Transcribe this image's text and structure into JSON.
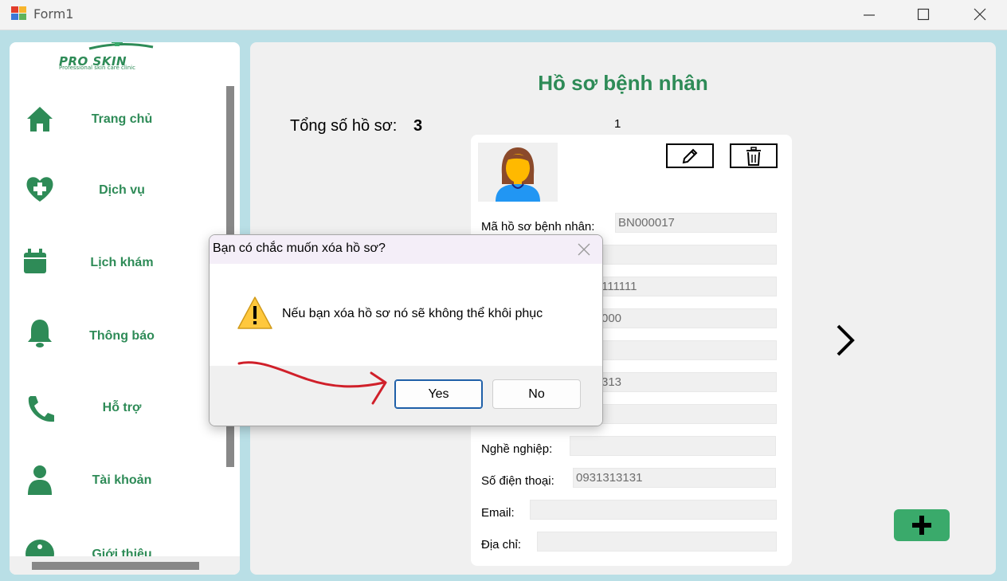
{
  "window": {
    "title": "Form1"
  },
  "colors": {
    "accent": "#2e8b57",
    "background": "#b9dfe6",
    "add_button": "#3aaa6b",
    "annotation_arrow": "#d0202a"
  },
  "sidebar": {
    "logo_text": "PRO SKIN",
    "logo_subtext": "Professional skin care clinic",
    "items": [
      {
        "label": "Trang chủ",
        "icon": "home-icon"
      },
      {
        "label": "Dịch vụ",
        "icon": "heart-plus-icon"
      },
      {
        "label": "Lịch khám",
        "icon": "calendar-icon"
      },
      {
        "label": "Thông báo",
        "icon": "bell-icon"
      },
      {
        "label": "Hỗ trợ",
        "icon": "phone-icon"
      },
      {
        "label": "Tài khoản",
        "icon": "user-icon"
      },
      {
        "label": "Giới thiệu",
        "icon": "info-icon"
      }
    ]
  },
  "main": {
    "title": "Hồ sơ bệnh nhân",
    "total_label": "Tổng số hồ sơ:",
    "total_count": "3",
    "page_number": "1",
    "card": {
      "fields": [
        {
          "label": "Mã hồ sơ bệnh nhân:",
          "value": "BN000017"
        },
        {
          "label": "",
          "value": ""
        },
        {
          "label": "",
          "value": "111111"
        },
        {
          "label": "",
          "value": "000"
        },
        {
          "label": "",
          "value": ""
        },
        {
          "label": "",
          "value": "313"
        },
        {
          "label": "",
          "value": ""
        },
        {
          "label": "Nghề nghiệp:",
          "value": ""
        },
        {
          "label": "Số điện thoại:",
          "value": "0931313131"
        },
        {
          "label": "Email:",
          "value": ""
        },
        {
          "label": "Địa chỉ:",
          "value": ""
        }
      ]
    }
  },
  "dialog": {
    "title": "Bạn có chắc muốn xóa hồ sơ?",
    "message": "Nếu bạn xóa hồ sơ nó sẽ không thể khôi phục",
    "yes_label": "Yes",
    "no_label": "No"
  }
}
